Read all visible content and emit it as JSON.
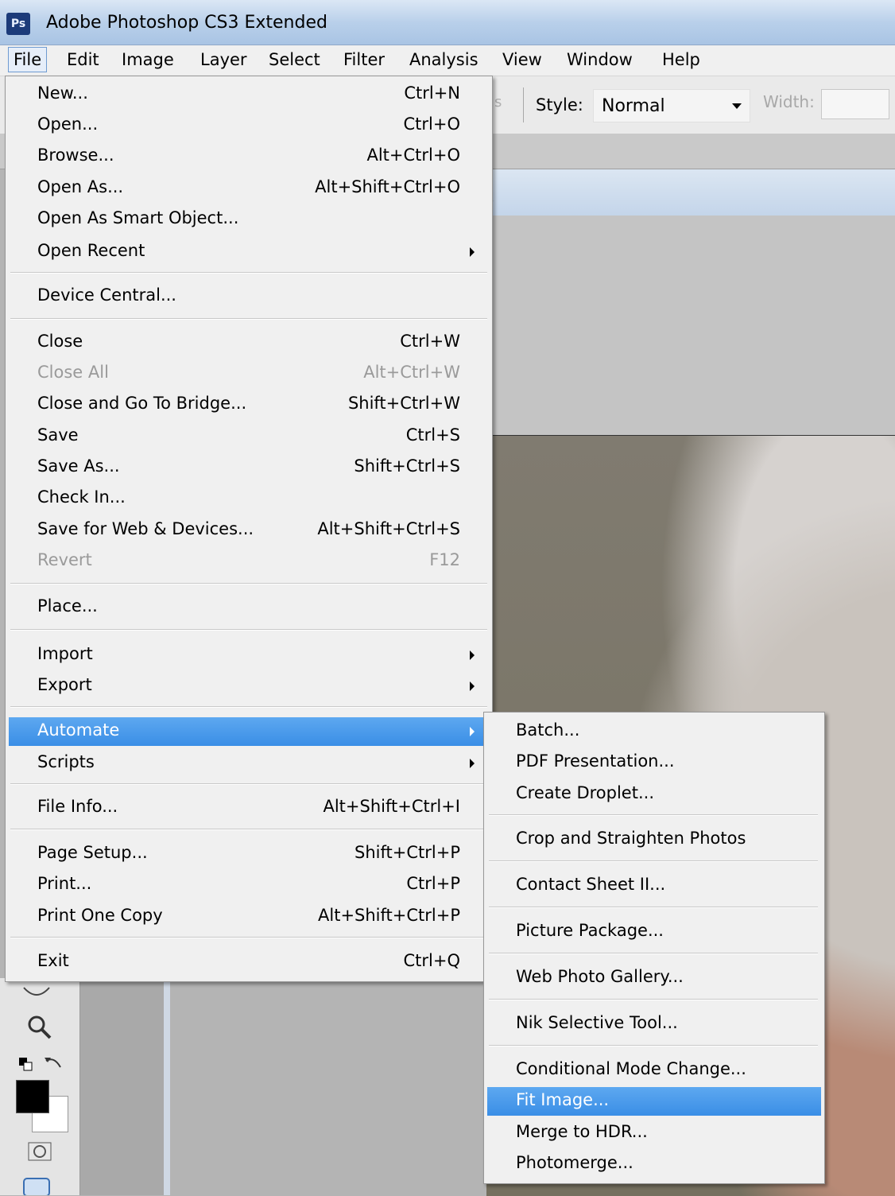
{
  "app": {
    "logo": "Ps",
    "title": "Adobe Photoshop CS3 Extended"
  },
  "menubar": [
    "File",
    "Edit",
    "Image",
    "Layer",
    "Select",
    "Filter",
    "Analysis",
    "View",
    "Window",
    "Help"
  ],
  "options": {
    "faint_text": "s",
    "style_label": "Style:",
    "style_value": "Normal",
    "width_label": "Width:",
    "width_value": ""
  },
  "document": {
    "title_fragment": ")"
  },
  "file_menu": {
    "items": [
      {
        "label": "New...",
        "shortcut": "Ctrl+N"
      },
      {
        "label": "Open...",
        "shortcut": "Ctrl+O"
      },
      {
        "label": "Browse...",
        "shortcut": "Alt+Ctrl+O"
      },
      {
        "label": "Open As...",
        "shortcut": "Alt+Shift+Ctrl+O"
      },
      {
        "label": "Open As Smart Object...",
        "shortcut": ""
      },
      {
        "label": "Open Recent",
        "shortcut": "",
        "submenu": true
      },
      {
        "label": "Device Central...",
        "shortcut": ""
      },
      {
        "label": "Close",
        "shortcut": "Ctrl+W"
      },
      {
        "label": "Close All",
        "shortcut": "Alt+Ctrl+W",
        "disabled": true
      },
      {
        "label": "Close and Go To Bridge...",
        "shortcut": "Shift+Ctrl+W"
      },
      {
        "label": "Save",
        "shortcut": "Ctrl+S"
      },
      {
        "label": "Save As...",
        "shortcut": "Shift+Ctrl+S"
      },
      {
        "label": "Check In...",
        "shortcut": ""
      },
      {
        "label": "Save for Web & Devices...",
        "shortcut": "Alt+Shift+Ctrl+S"
      },
      {
        "label": "Revert",
        "shortcut": "F12",
        "disabled": true
      },
      {
        "label": "Place...",
        "shortcut": ""
      },
      {
        "label": "Import",
        "shortcut": "",
        "submenu": true
      },
      {
        "label": "Export",
        "shortcut": "",
        "submenu": true
      },
      {
        "label": "Automate",
        "shortcut": "",
        "submenu": true,
        "highlighted": true
      },
      {
        "label": "Scripts",
        "shortcut": "",
        "submenu": true
      },
      {
        "label": "File Info...",
        "shortcut": "Alt+Shift+Ctrl+I"
      },
      {
        "label": "Page Setup...",
        "shortcut": "Shift+Ctrl+P"
      },
      {
        "label": "Print...",
        "shortcut": "Ctrl+P"
      },
      {
        "label": "Print One Copy",
        "shortcut": "Alt+Shift+Ctrl+P"
      },
      {
        "label": "Exit",
        "shortcut": "Ctrl+Q"
      }
    ]
  },
  "automate_menu": {
    "items": [
      {
        "label": "Batch..."
      },
      {
        "label": "PDF Presentation..."
      },
      {
        "label": "Create Droplet..."
      },
      {
        "label": "Crop and Straighten Photos"
      },
      {
        "label": "Contact Sheet II..."
      },
      {
        "label": "Picture Package..."
      },
      {
        "label": "Web Photo Gallery..."
      },
      {
        "label": "Nik Selective Tool..."
      },
      {
        "label": "Conditional Mode Change..."
      },
      {
        "label": "Fit Image...",
        "highlighted": true
      },
      {
        "label": "Merge to HDR..."
      },
      {
        "label": "Photomerge..."
      }
    ]
  },
  "tools": {
    "icons": [
      "hand-icon",
      "zoom-icon",
      "default-colors-icon",
      "swap-colors-icon",
      "quick-mask-icon",
      "screen-mode-icon"
    ],
    "foreground_color": "#000000",
    "background_color": "#ffffff"
  },
  "colors": {
    "highlight": "#3a8ee6",
    "menu_bg": "#f0f0f0",
    "titlebar": "#b9d0ea"
  }
}
